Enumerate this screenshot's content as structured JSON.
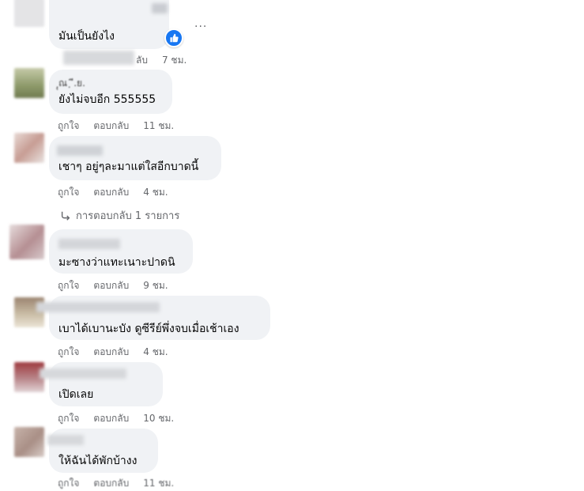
{
  "actions": {
    "like_label": "ถูกใจ",
    "reply_label": "ตอบกลับ"
  },
  "comments": [
    {
      "text": "มันเป็นยังไง",
      "time": "7 ชม."
    },
    {
      "header_partial": "ฺุณ  ฺ ี.ย.",
      "text": "ยังไม่จบอีก 555555",
      "time": "11 ชม."
    },
    {
      "text": "เชาๆ อยู่ๆละมาแต่ใสอีกบาดนี้",
      "time": "4 ชม."
    },
    {
      "text": "มะซางว่าแทะเนาะปาดนิ",
      "time": "9 ชม."
    },
    {
      "text": "เบาได้เบานะบัง ดูซีรีย์พึ่งจบเมื่อเช้าเอง",
      "time": "4 ชม."
    },
    {
      "text": "เปิดเลย",
      "time": "10 ชม."
    },
    {
      "text": "ให้ฉันได้พักบ้างง",
      "time": "11 ชม."
    }
  ],
  "replies_link": {
    "label": "การตอบกลับ 1 รายการ"
  },
  "colors": {
    "bubble": "#f0f2f5",
    "meta_text": "#65676b",
    "like_blue": "#1877f2"
  },
  "icons": {
    "like": "thumbs-up-icon",
    "more": "more-options-icon",
    "reply_arrow": "reply-arrow-icon"
  }
}
